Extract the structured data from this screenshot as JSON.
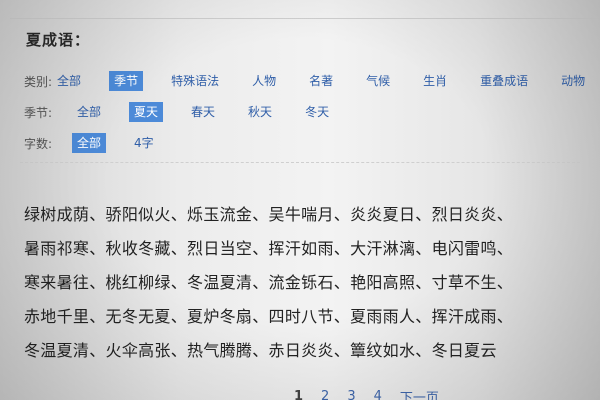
{
  "title": "夏成语：",
  "filters": [
    {
      "label": "类别:",
      "options": [
        {
          "label": "全部",
          "selected": false
        },
        {
          "label": "季节",
          "selected": true
        },
        {
          "label": "特殊语法",
          "selected": false
        },
        {
          "label": "人物",
          "selected": false
        },
        {
          "label": "名著",
          "selected": false
        },
        {
          "label": "气候",
          "selected": false
        },
        {
          "label": "生肖",
          "selected": false
        },
        {
          "label": "重叠成语",
          "selected": false
        },
        {
          "label": "动物",
          "selected": false
        }
      ]
    },
    {
      "label": "季节:",
      "options": [
        {
          "label": "全部",
          "selected": false
        },
        {
          "label": "夏天",
          "selected": true
        },
        {
          "label": "春天",
          "selected": false
        },
        {
          "label": "秋天",
          "selected": false
        },
        {
          "label": "冬天",
          "selected": false
        }
      ]
    },
    {
      "label": "字数:",
      "options": [
        {
          "label": "全部",
          "selected": true
        },
        {
          "label": "4字",
          "selected": false
        }
      ]
    }
  ],
  "idioms": [
    [
      "绿树成荫",
      "骄阳似火",
      "烁玉流金",
      "吴牛喘月",
      "炎炎夏日",
      "烈日炎炎"
    ],
    [
      "暑雨祁寒",
      "秋收冬藏",
      "烈日当空",
      "挥汗如雨",
      "大汗淋漓",
      "电闪雷鸣"
    ],
    [
      "寒来暑往",
      "桃红柳绿",
      "冬温夏清",
      "流金铄石",
      "艳阳高照",
      "寸草不生"
    ],
    [
      "赤地千里",
      "无冬无夏",
      "夏炉冬扇",
      "四时八节",
      "夏雨雨人",
      "挥汗成雨"
    ],
    [
      "冬温夏清",
      "火伞高张",
      "热气腾腾",
      "赤日炎炎",
      "簟纹如水",
      "冬日夏云"
    ]
  ],
  "separator": "、",
  "pagination": {
    "pages": [
      "1",
      "2",
      "3",
      "4"
    ],
    "current": "1",
    "next_label": "下一页"
  },
  "colors": {
    "accent": "#4c8ad8",
    "link": "#2f5ea8",
    "text": "#222222"
  }
}
